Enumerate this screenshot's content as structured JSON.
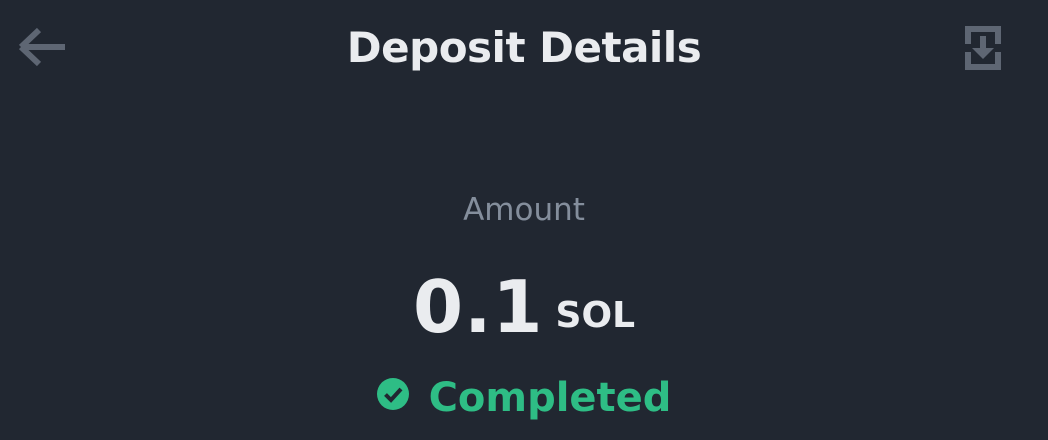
{
  "header": {
    "title": "Deposit Details",
    "back_icon": "arrow-left-icon",
    "download_icon": "download-icon"
  },
  "amount": {
    "label": "Amount",
    "value": "0.1",
    "unit": "SOL"
  },
  "status": {
    "text": "Completed",
    "icon": "check-circle-icon",
    "color": "#2EBD85"
  },
  "colors": {
    "background": "#212731",
    "text_primary": "#EAECEF",
    "text_secondary": "#848E9C",
    "icon_muted": "#5E6673",
    "success": "#2EBD85"
  }
}
